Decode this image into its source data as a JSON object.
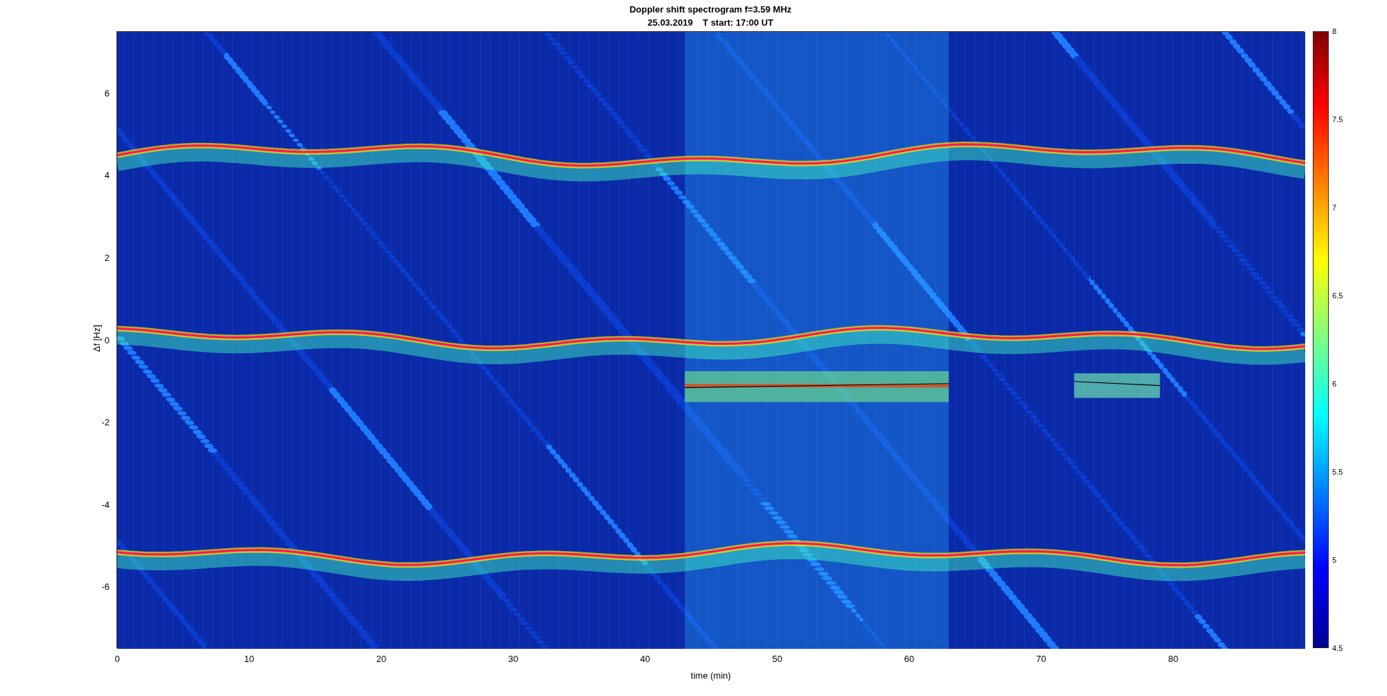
{
  "title": {
    "line_1": "Doppler shift spectrogram f=3.59 MHz",
    "line_2": "25.03.2019    T start: 17:00 UT"
  },
  "x_axis": {
    "label": "time (min)",
    "ticks": [
      "0",
      "10",
      "20",
      "30",
      "40",
      "50",
      "60",
      "70",
      "80"
    ]
  },
  "y_axis": {
    "label": "Δf [Hz]",
    "ticks": [
      "6",
      "4",
      "2",
      "0",
      "-2",
      "-4",
      "-6"
    ]
  },
  "colorbar": {
    "ticks": [
      "8",
      "7.5",
      "7",
      "6.5",
      "6",
      "5.5",
      "5",
      "4.5"
    ]
  }
}
